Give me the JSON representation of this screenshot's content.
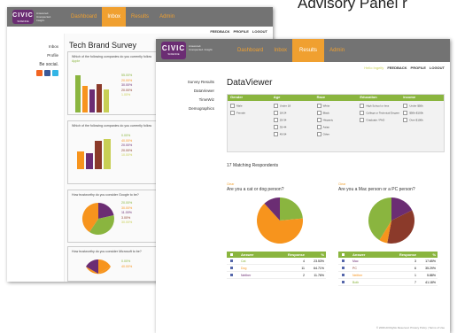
{
  "slide": {
    "title": "Advisory Panel r"
  },
  "back_window": {
    "logo": "CIVIC",
    "logo_sub": "SCIENCE",
    "tagline": "Answered. Unexpected. Insight.",
    "nav": [
      "Dashboard",
      "Inbox",
      "Results",
      "Admin"
    ],
    "util": [
      "FEEDBACK",
      "PROFILE",
      "LOGOUT"
    ],
    "side": [
      "Inbox",
      "Profile",
      "Be social."
    ],
    "page_title": "Tech Brand Survey",
    "q1": "Which of the following companies do you currently follow",
    "q1_link": "Apple",
    "q1_pcts": [
      "55.00%",
      "20.00%",
      "30.00%",
      "20.00%",
      "1.00%"
    ],
    "q2": "Which of the following companies do you currently follow",
    "q2_pcts": [
      "0.00%",
      "40.00%",
      "20.00%",
      "20.00%",
      "10.00%"
    ],
    "q3": "How trustworthy do you consider Google to be?",
    "q3_pcts": [
      "20.00%",
      "30.00%",
      "11.00%",
      "3.00%",
      "30.00%"
    ],
    "q4": "How trustworthy do you consider Microsoft to be?",
    "q4_pcts": [
      "0.00%",
      "40.00%"
    ]
  },
  "front_window": {
    "logo": "CIVIC",
    "logo_sub": "SCIENCE",
    "tagline": "Answered. Unexpected. Insight.",
    "nav": [
      "Dashboard",
      "Inbox",
      "Results",
      "Admin"
    ],
    "util_user": "Hello Ingelfy",
    "util": [
      "FEEDBACK",
      "PROFILE",
      "LOGOUT"
    ],
    "side": [
      "Survey Results",
      "DataViewer",
      "TimeWiz",
      "Demographics"
    ],
    "page_title": "DataViewer",
    "filter_headers": [
      "Gender",
      "Age",
      "Race",
      "Education",
      "Income"
    ],
    "filter_cols": [
      [
        "Male",
        "Female"
      ],
      [
        "Under 18",
        "18-24",
        "25-34",
        "35-44",
        "45-54"
      ],
      [
        "White",
        "Black",
        "Hispanic",
        "Asian",
        "Other"
      ],
      [
        "High School or less",
        "College or Technical Degree",
        "Graduate / PhD"
      ],
      [
        "Under $50k",
        "$50k-$100k",
        "Over $100k"
      ]
    ],
    "matching": "17 Matching Respondents",
    "chart_left": {
      "tag": "Clear",
      "question": "Are you a cat or dog person?"
    },
    "chart_right": {
      "tag": "Clear",
      "question": "Are you a Mac person or a PC person?"
    },
    "table_headers": [
      "Answer",
      "Response",
      "%"
    ],
    "left_rows": [
      {
        "answer": "Cat",
        "count": "4",
        "pct": "23.53%"
      },
      {
        "answer": "Dog",
        "count": "11",
        "pct": "64.71%"
      },
      {
        "answer": "Neither",
        "count": "2",
        "pct": "11.76%"
      }
    ],
    "right_rows": [
      {
        "answer": "Mac",
        "count": "3",
        "pct": "17.65%"
      },
      {
        "answer": "PC",
        "count": "6",
        "pct": "35.29%"
      },
      {
        "answer": "Neither",
        "count": "1",
        "pct": "5.88%"
      },
      {
        "answer": "Both",
        "count": "7",
        "pct": "41.18%"
      }
    ],
    "footer": "© 2009 All Rights Reserved. Privacy Policy | Terms of Use"
  },
  "chart_data": [
    {
      "type": "pie",
      "title": "Are you a cat or dog person?",
      "categories": [
        "Cat",
        "Dog",
        "Neither"
      ],
      "values": [
        23.53,
        64.71,
        11.76
      ],
      "colors": [
        "#8ab53f",
        "#f7941d",
        "#6b2d73"
      ]
    },
    {
      "type": "pie",
      "title": "Are you a Mac person or a PC person?",
      "categories": [
        "Mac",
        "PC",
        "Neither",
        "Both"
      ],
      "values": [
        17.65,
        35.29,
        5.88,
        41.18
      ],
      "colors": [
        "#6b2d73",
        "#8b3a2a",
        "#f7941d",
        "#8ab53f"
      ]
    }
  ],
  "colors": {
    "accent": "#f0a030",
    "brand": "#6b2d73",
    "green": "#8ab53f",
    "topbar": "#737373"
  }
}
